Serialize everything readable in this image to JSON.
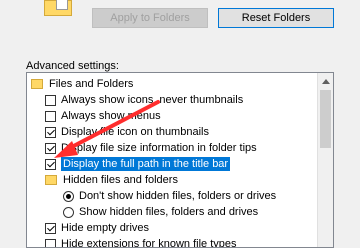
{
  "buttons": {
    "apply_label": "Apply to Folders",
    "reset_label": "Reset Folders"
  },
  "advanced_label": "Advanced settings:",
  "tree": {
    "root_label": "Files and Folders",
    "items": [
      {
        "label": "Always show icons, never thumbnails",
        "checked": false
      },
      {
        "label": "Always show menus",
        "checked": false
      },
      {
        "label": "Display file icon on thumbnails",
        "checked": true
      },
      {
        "label": "Display file size information in folder tips",
        "checked": true
      },
      {
        "label": "Display the full path in the title bar",
        "checked": true,
        "highlighted": true
      }
    ],
    "hidden_group_label": "Hidden files and folders",
    "hidden_options": [
      {
        "label": "Don't show hidden files, folders or drives",
        "selected": true
      },
      {
        "label": "Show hidden files, folders and drives",
        "selected": false
      }
    ],
    "more_items": [
      {
        "label": "Hide empty drives",
        "checked": true
      },
      {
        "label": "Hide extensions for known file types",
        "checked": false
      }
    ]
  },
  "colors": {
    "highlight": "#0078d7",
    "arrow": "#ff2d2d",
    "folder": "#ffd866"
  },
  "icons": [
    "folder-icon",
    "checkbox",
    "radio-button",
    "scroll-up-icon",
    "annotation-arrow"
  ]
}
